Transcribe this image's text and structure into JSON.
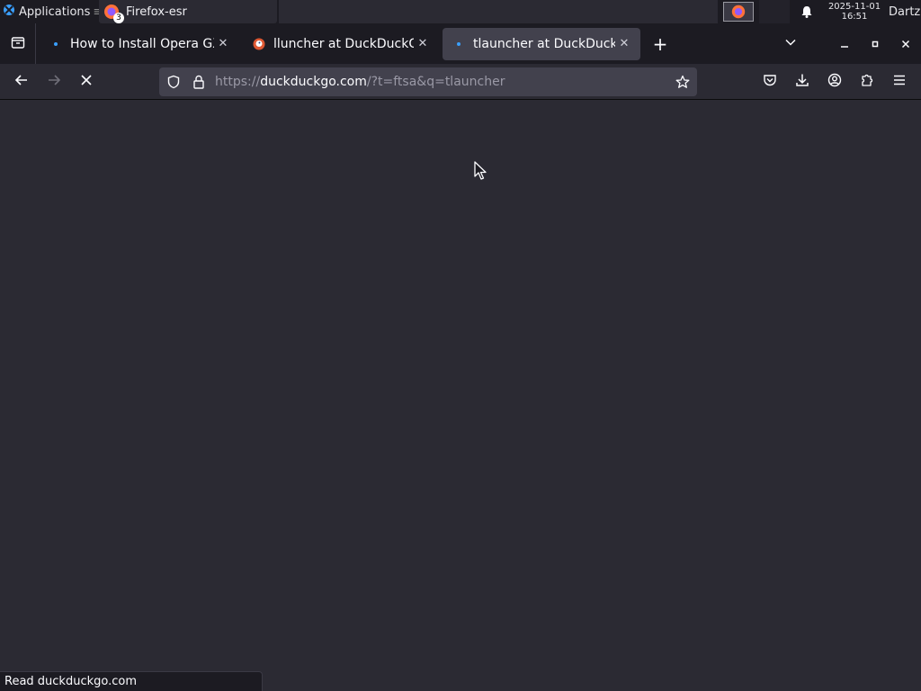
{
  "taskbar": {
    "apps_label": "Applications",
    "window_title": "Firefox-esr",
    "window_badge": "3",
    "clock_date": "2025-11-01",
    "clock_time": "16:51",
    "user": "Dartz"
  },
  "tabs": [
    {
      "title": "How to Install Opera GX",
      "favicon": "loading-dot",
      "active": false
    },
    {
      "title": "lluncher at DuckDuckGo",
      "favicon": "duckduckgo-icon",
      "active": false
    },
    {
      "title": "tlauncher at DuckDuckGo",
      "favicon": "loading-dot",
      "active": true
    }
  ],
  "navbar": {
    "url_prefix": "https://",
    "url_host": "duckduckgo.com",
    "url_path": "/?t=ftsa&q=tlauncher"
  },
  "status": {
    "text": "Read duckduckgo.com"
  },
  "colors": {
    "background": "#2b2a33",
    "chrome_dark": "#1c1b22",
    "active_tab": "#42414d",
    "accent": "#3aa0ff"
  }
}
